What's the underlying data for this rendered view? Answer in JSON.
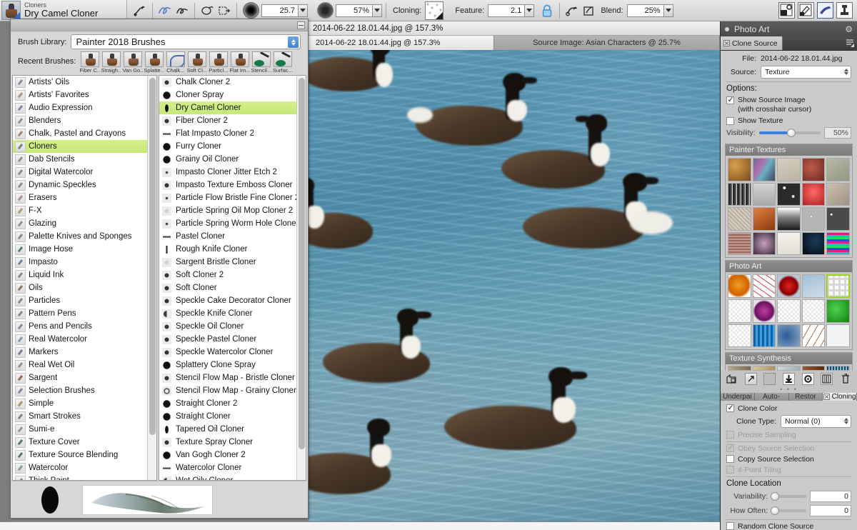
{
  "propbar": {
    "brush_category": "Cloners",
    "brush_name": "Dry Camel Cloner",
    "size_value": "25.7",
    "opacity_value": "57%",
    "cloning_label": "Cloning:",
    "feature_label": "Feature:",
    "feature_value": "2.1",
    "blend_label": "Blend:",
    "blend_value": "25%"
  },
  "brush_window": {
    "library_label": "Brush Library:",
    "library_value": "Painter 2018 Brushes",
    "recent_label": "Recent Brushes:",
    "recent": [
      {
        "caption": "Fiber C...",
        "kind": "stamp"
      },
      {
        "caption": "Straigh...",
        "kind": "stamp"
      },
      {
        "caption": "Van Go...",
        "kind": "stamp"
      },
      {
        "caption": "Splatte...",
        "kind": "stamp"
      },
      {
        "caption": "Chalk...",
        "kind": "pen"
      },
      {
        "caption": "Soft Cl...",
        "kind": "stamp"
      },
      {
        "caption": "Particl...",
        "kind": "stamp"
      },
      {
        "caption": "Flat Im...",
        "kind": "stamp"
      },
      {
        "caption": "Stencil...",
        "kind": "green"
      },
      {
        "caption": "Surfac...",
        "kind": "green"
      }
    ],
    "categories": [
      {
        "label": "Artists' Oils",
        "selected": false
      },
      {
        "label": "Artists' Favorites",
        "selected": false
      },
      {
        "label": "Audio Expression",
        "selected": false
      },
      {
        "label": "Blenders",
        "selected": false
      },
      {
        "label": "Chalk, Pastel and Crayons",
        "selected": false
      },
      {
        "label": "Cloners",
        "selected": true
      },
      {
        "label": "Dab Stencils",
        "selected": false
      },
      {
        "label": "Digital Watercolor",
        "selected": false
      },
      {
        "label": "Dynamic Speckles",
        "selected": false
      },
      {
        "label": "Erasers",
        "selected": false
      },
      {
        "label": "F-X",
        "selected": false
      },
      {
        "label": "Glazing",
        "selected": false
      },
      {
        "label": "Palette Knives and Sponges",
        "selected": false
      },
      {
        "label": "Image Hose",
        "selected": false
      },
      {
        "label": "Impasto",
        "selected": false
      },
      {
        "label": "Liquid Ink",
        "selected": false
      },
      {
        "label": "Oils",
        "selected": false
      },
      {
        "label": "Particles",
        "selected": false
      },
      {
        "label": "Pattern Pens",
        "selected": false
      },
      {
        "label": "Pens and Pencils",
        "selected": false
      },
      {
        "label": "Real Watercolor",
        "selected": false
      },
      {
        "label": "Markers",
        "selected": false
      },
      {
        "label": "Real Wet Oil",
        "selected": false
      },
      {
        "label": "Sargent",
        "selected": false
      },
      {
        "label": "Selection Brushes",
        "selected": false
      },
      {
        "label": "Simple",
        "selected": false
      },
      {
        "label": "Smart Strokes",
        "selected": false
      },
      {
        "label": "Sumi-e",
        "selected": false
      },
      {
        "label": "Texture Cover",
        "selected": false
      },
      {
        "label": "Texture Source Blending",
        "selected": false
      },
      {
        "label": "Watercolor",
        "selected": false
      },
      {
        "label": "Thick Paint",
        "selected": false
      }
    ],
    "variants": [
      {
        "label": "Chalk Cloner 2",
        "selected": false,
        "dab": "small-dot"
      },
      {
        "label": "Cloner Spray",
        "selected": false,
        "dab": "solid-round"
      },
      {
        "label": "Dry Camel Cloner",
        "selected": true,
        "dab": "tall-oval"
      },
      {
        "label": "Fiber Cloner 2",
        "selected": false,
        "dab": "small-dot"
      },
      {
        "label": "Flat Impasto Cloner 2",
        "selected": false,
        "dab": "dash"
      },
      {
        "label": "Furry Cloner",
        "selected": false,
        "dab": "solid-round"
      },
      {
        "label": "Grainy Oil Cloner",
        "selected": false,
        "dab": "solid-round"
      },
      {
        "label": "Impasto Cloner Jitter Etch 2",
        "selected": false,
        "dab": "tiny-dot"
      },
      {
        "label": "Impasto Texture Emboss Cloner",
        "selected": false,
        "dab": "small-dot"
      },
      {
        "label": "Particle Flow Bristle Fine Cloner 2",
        "selected": false,
        "dab": "tiny-dot"
      },
      {
        "label": "Particle Spring Oil Mop Cloner 2",
        "selected": false,
        "dab": "faint"
      },
      {
        "label": "Particle Spring Worm Hole Cloner 2",
        "selected": false,
        "dab": "tiny-dot"
      },
      {
        "label": "Pastel Cloner",
        "selected": false,
        "dab": "dash"
      },
      {
        "label": "Rough Knife Cloner",
        "selected": false,
        "dab": "bar"
      },
      {
        "label": "Sargent Bristle Cloner",
        "selected": false,
        "dab": "faint"
      },
      {
        "label": "Soft Cloner 2",
        "selected": false,
        "dab": "small-dot"
      },
      {
        "label": "Soft Cloner",
        "selected": false,
        "dab": "small-dot"
      },
      {
        "label": "Speckle Cake Decorator Cloner",
        "selected": false,
        "dab": "small-dot"
      },
      {
        "label": "Speckle Knife Cloner",
        "selected": false,
        "dab": "half-dot"
      },
      {
        "label": "Speckle Oil Cloner",
        "selected": false,
        "dab": "small-dot"
      },
      {
        "label": "Speckle Pastel Cloner",
        "selected": false,
        "dab": "small-dot"
      },
      {
        "label": "Speckle Watercolor Cloner",
        "selected": false,
        "dab": "small-dot"
      },
      {
        "label": "Splattery Clone Spray",
        "selected": false,
        "dab": "solid-round"
      },
      {
        "label": "Stencil Flow Map - Bristle Cloner",
        "selected": false,
        "dab": "small-dot"
      },
      {
        "label": "Stencil Flow Map - Grainy Cloner",
        "selected": false,
        "dab": "ring"
      },
      {
        "label": "Straight Cloner 2",
        "selected": false,
        "dab": "solid-round"
      },
      {
        "label": "Straight Cloner",
        "selected": false,
        "dab": "solid-round"
      },
      {
        "label": "Tapered Oil Cloner",
        "selected": false,
        "dab": "tall-oval"
      },
      {
        "label": "Texture Spray Cloner",
        "selected": false,
        "dab": "small-dot"
      },
      {
        "label": "Van Gogh Cloner 2",
        "selected": false,
        "dab": "solid-round"
      },
      {
        "label": "Watercolor Cloner",
        "selected": false,
        "dab": "dash"
      },
      {
        "label": "Wet Oily Cloner",
        "selected": false,
        "dab": "half-dot"
      }
    ]
  },
  "document": {
    "window_title": "2014-06-22 18.01.44.jpg @ 157.3%",
    "tab_active": "2014-06-22 18.01.44.jpg @ 157.3%",
    "tab_inactive": "Source Image: Asian Characters @ 25.7%"
  },
  "photo_art": {
    "panel_title": "Photo Art",
    "tab_clone_source": "Clone Source",
    "file_label": "File:",
    "file_value": "2014-06-22 18.01.44.jpg",
    "source_label": "Source:",
    "source_value": "Texture",
    "options_label": "Options:",
    "show_source_image": "Show Source Image",
    "crosshair_note": "(with crosshair cursor)",
    "show_texture": "Show Texture",
    "visibility_label": "Visibility:",
    "visibility_value": "50%",
    "libraries": [
      {
        "title": "Painter Textures"
      },
      {
        "title": "Photo Art"
      },
      {
        "title": "Texture Synthesis"
      }
    ],
    "subtabs": [
      {
        "label": "Underpai",
        "active": false
      },
      {
        "label": "Auto-",
        "active": false
      },
      {
        "label": "Restor",
        "active": false
      },
      {
        "label": "Cloning",
        "active": true
      }
    ],
    "cloning": {
      "clone_color": "Clone Color",
      "clone_type_label": "Clone Type:",
      "clone_type_value": "Normal (0)",
      "precise_sampling": "Precise Sampling",
      "obey_source_selection": "Obey Source Selection",
      "copy_source_selection": "Copy Source Selection",
      "four_point_tiling": "4-Point Tiling",
      "clone_location": "Clone Location",
      "variability_label": "Variability:",
      "variability_value": "0",
      "how_often_label": "How Often:",
      "how_often_value": "0",
      "random_clone_source": "Random Clone Source"
    }
  },
  "colors": {
    "selection_green": "#cbe97f",
    "accent_blue": "#3b80e0",
    "panel_dark": "#4b4b4b",
    "panel_light": "#cacaca",
    "water_blue": "#5c9cba"
  }
}
